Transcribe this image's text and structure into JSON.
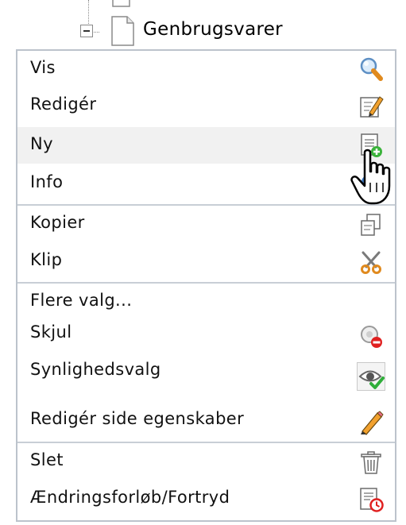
{
  "tree": {
    "node_label": "Genbrugsvarer"
  },
  "menu": {
    "items": [
      {
        "label": "Vis",
        "icon": "magnifier-icon"
      },
      {
        "label": "Redigér",
        "icon": "edit-page-icon"
      },
      {
        "label": "Ny",
        "icon": "new-page-icon",
        "state": "hover"
      },
      {
        "label": "Info",
        "icon": "info-icon"
      },
      {
        "label": "Kopier",
        "icon": "copy-icon"
      },
      {
        "label": "Klip",
        "icon": "scissors-icon"
      },
      {
        "label": "Flere valg..."
      },
      {
        "label": "Skjul",
        "icon": "hide-icon"
      },
      {
        "label": "Synlighedsvalg",
        "icon": "visibility-icon"
      },
      {
        "label": "Redigér side egenskaber",
        "icon": "pencil-icon"
      },
      {
        "label": "Slet",
        "icon": "trash-icon"
      },
      {
        "label": "Ændringsforløb/Fortryd",
        "icon": "history-icon"
      }
    ]
  },
  "colors": {
    "menu_border": "#bcc3cc",
    "hover_bg": "#f1f1f1",
    "accent_green": "#3bb33b",
    "accent_red": "#e02020",
    "accent_orange": "#f2a12e"
  }
}
